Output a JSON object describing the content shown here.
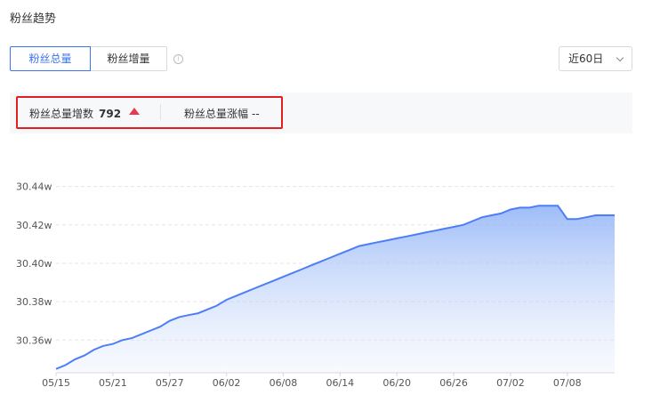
{
  "section_title": "粉丝趋势",
  "tabs": [
    {
      "label": "粉丝总量",
      "active": true
    },
    {
      "label": "粉丝增量",
      "active": false
    }
  ],
  "range_select": {
    "value": "近60日"
  },
  "stats": {
    "increase_label": "粉丝总量增数",
    "increase_value": "792",
    "growth_label": "粉丝总量涨幅",
    "growth_value": "--"
  },
  "colors": {
    "accent": "#3c73f0",
    "highlight_border": "#e02020",
    "up": "#e8384f"
  },
  "chart_data": {
    "type": "area",
    "y_unit": "w",
    "y_ticks": [
      "30.36w",
      "30.38w",
      "30.40w",
      "30.42w",
      "30.44w"
    ],
    "y_tick_values": [
      30.36,
      30.38,
      30.4,
      30.42,
      30.44
    ],
    "ylim": [
      30.343,
      30.463
    ],
    "x_ticks": [
      "05/15",
      "05/21",
      "05/27",
      "06/02",
      "06/08",
      "06/14",
      "06/20",
      "06/26",
      "07/02",
      "07/08"
    ],
    "x": [
      "05/15",
      "05/16",
      "05/17",
      "05/18",
      "05/19",
      "05/20",
      "05/21",
      "05/22",
      "05/23",
      "05/24",
      "05/25",
      "05/26",
      "05/27",
      "05/28",
      "05/29",
      "05/30",
      "05/31",
      "06/01",
      "06/02",
      "06/03",
      "06/04",
      "06/05",
      "06/06",
      "06/07",
      "06/08",
      "06/09",
      "06/10",
      "06/11",
      "06/12",
      "06/13",
      "06/14",
      "06/15",
      "06/16",
      "06/17",
      "06/18",
      "06/19",
      "06/20",
      "06/21",
      "06/22",
      "06/23",
      "06/24",
      "06/25",
      "06/26",
      "06/27",
      "06/28",
      "06/29",
      "06/30",
      "07/01",
      "07/02",
      "07/03",
      "07/04",
      "07/05",
      "07/06",
      "07/07",
      "07/08",
      "07/09",
      "07/10",
      "07/11",
      "07/12",
      "07/13"
    ],
    "values": [
      30.345,
      30.347,
      30.35,
      30.352,
      30.355,
      30.357,
      30.358,
      30.36,
      30.361,
      30.363,
      30.365,
      30.367,
      30.37,
      30.372,
      30.373,
      30.374,
      30.376,
      30.378,
      30.381,
      30.383,
      30.385,
      30.387,
      30.389,
      30.391,
      30.393,
      30.395,
      30.397,
      30.399,
      30.401,
      30.403,
      30.405,
      30.407,
      30.409,
      30.41,
      30.411,
      30.412,
      30.413,
      30.414,
      30.415,
      30.416,
      30.417,
      30.418,
      30.419,
      30.42,
      30.422,
      30.424,
      30.425,
      30.426,
      30.428,
      30.429,
      30.429,
      30.43,
      30.43,
      30.43,
      30.423,
      30.423,
      30.424,
      30.425,
      30.425,
      30.425
    ],
    "grid": true,
    "line_color": "#4d7ef7"
  }
}
